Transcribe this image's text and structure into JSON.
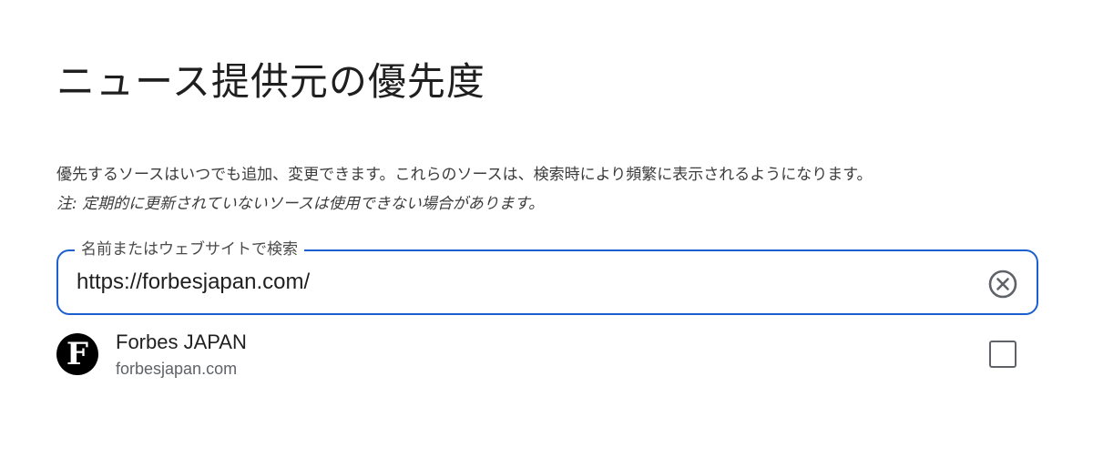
{
  "page": {
    "title": "ニュース提供元の優先度",
    "description": "優先するソースはいつでも追加、変更できます。これらのソースは、検索時により頻繁に表示されるようになります。",
    "note": "注: 定期的に更新されていないソースは使用できない場合があります。"
  },
  "search": {
    "label": "名前またはウェブサイトで検索",
    "value": "https://forbesjapan.com/",
    "clear_icon": "clear-circle-x-icon",
    "accent_color": "#1b5fd1"
  },
  "results": [
    {
      "logo_letter": "F",
      "name": "Forbes JAPAN",
      "domain": "forbesjapan.com",
      "checked": false
    }
  ]
}
